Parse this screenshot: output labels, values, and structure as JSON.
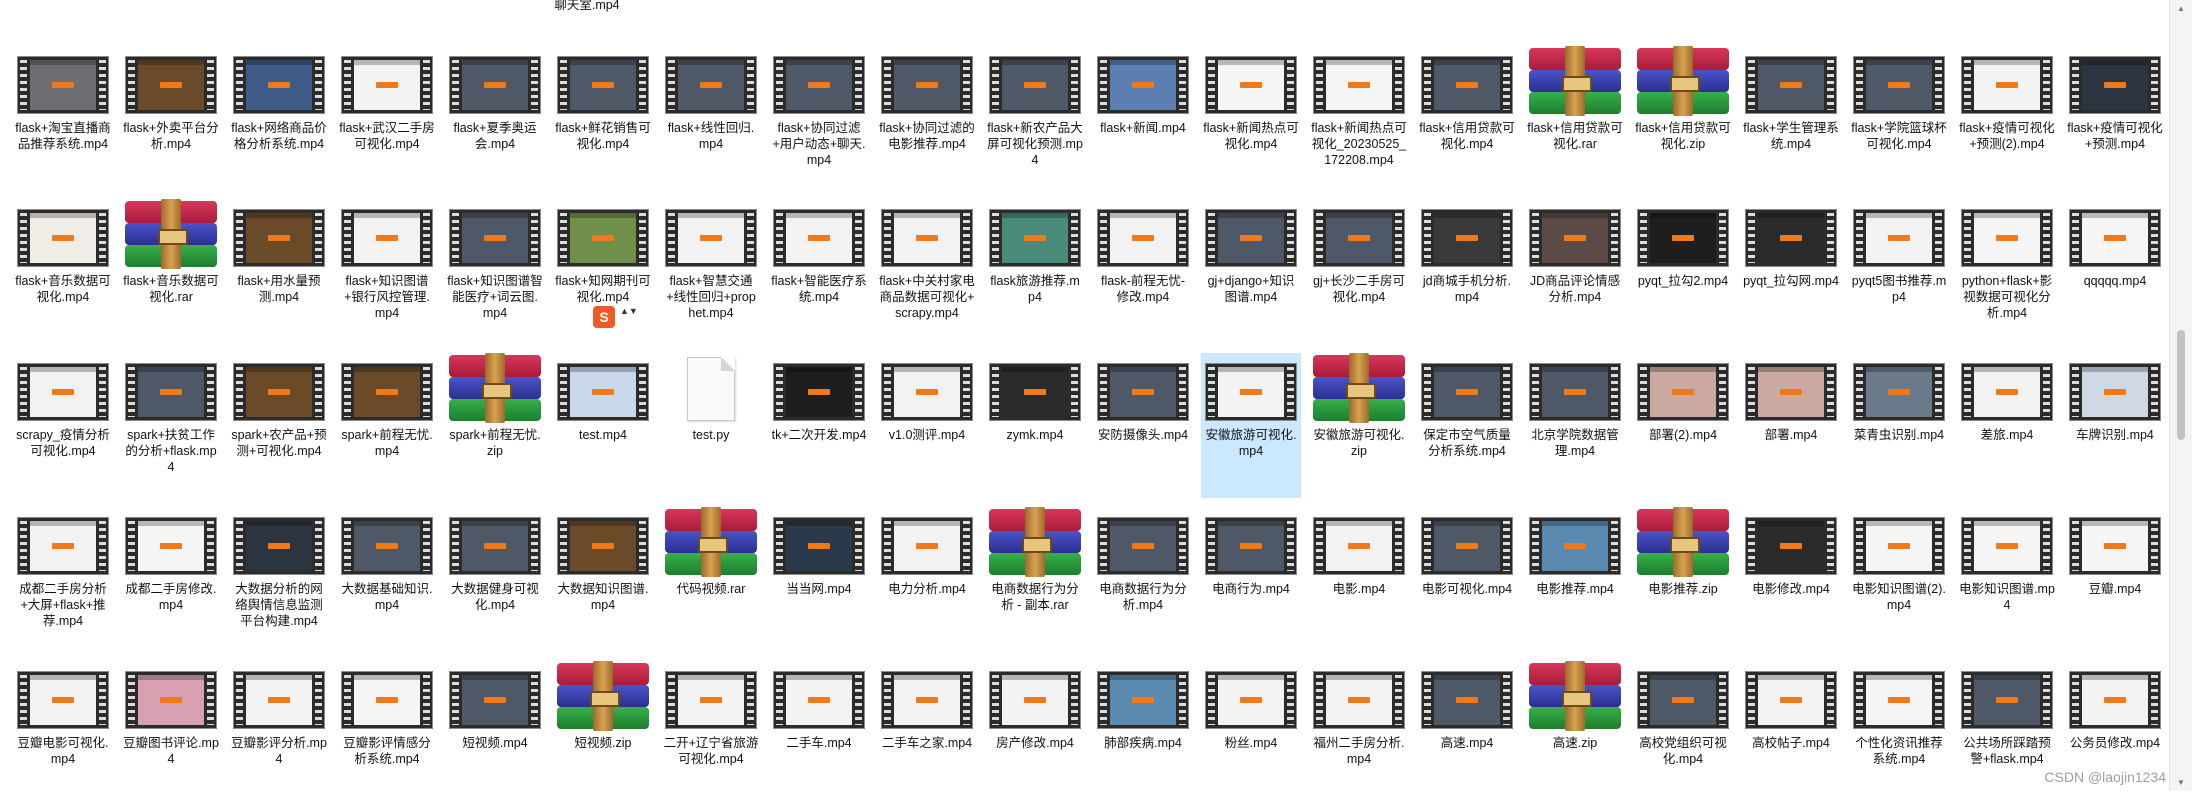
{
  "top_partial_label": "聊天室.mp4",
  "columns_x": [
    13,
    121,
    229,
    337,
    445,
    553,
    661,
    769,
    877,
    985,
    1093,
    1201,
    1309,
    1417,
    1525,
    1633,
    1741,
    1849,
    1957,
    2065
  ],
  "rows_y": [
    56,
    209,
    363,
    517,
    671
  ],
  "files": [
    [
      {
        "name": "flask+淘宝直播商品推荐系统.mp4",
        "type": "video",
        "theme": "#6c6e72"
      },
      {
        "name": "flask+外卖平台分析.mp4",
        "type": "video",
        "theme": "#6b4a2a"
      },
      {
        "name": "flask+网络商品价格分析系统.mp4",
        "type": "video",
        "theme": "#3e5a86"
      },
      {
        "name": "flask+武汉二手房可视化.mp4",
        "type": "video",
        "theme": "#f2f2f2"
      },
      {
        "name": "flask+夏季奥运会.mp4",
        "type": "video",
        "theme": "#4f5866"
      },
      {
        "name": "flask+鲜花销售可视化.mp4",
        "type": "video",
        "theme": "#4f5866"
      },
      {
        "name": "flask+线性回归.mp4",
        "type": "video",
        "theme": "#4f5866"
      },
      {
        "name": "flask+协同过滤+用户动态+聊天.mp4",
        "type": "video",
        "theme": "#4f5866"
      },
      {
        "name": "flask+协同过滤的电影推荐.mp4",
        "type": "video",
        "theme": "#4f5866"
      },
      {
        "name": "flask+新农产品大屏可视化预测.mp4",
        "type": "video",
        "theme": "#4f5866"
      },
      {
        "name": "flask+新闻.mp4",
        "type": "video",
        "theme": "#5a7fb0"
      },
      {
        "name": "flask+新闻热点可视化.mp4",
        "type": "video",
        "theme": "#f5f5f5"
      },
      {
        "name": "flask+新闻热点可视化_20230525_172208.mp4",
        "type": "video",
        "theme": "#f5f5f5"
      },
      {
        "name": "flask+信用贷款可视化.mp4",
        "type": "video",
        "theme": "#4f5866"
      },
      {
        "name": "flask+信用贷款可视化.rar",
        "type": "archive"
      },
      {
        "name": "flask+信用贷款可视化.zip",
        "type": "archive"
      },
      {
        "name": "flask+学生管理系统.mp4",
        "type": "video",
        "theme": "#4f5866"
      },
      {
        "name": "flask+学院篮球杯可视化.mp4",
        "type": "video",
        "theme": "#4f5866"
      },
      {
        "name": "flask+疫情可视化+预测(2).mp4",
        "type": "video",
        "theme": "#f2f2f2"
      },
      {
        "name": "flask+疫情可视化+预测.mp4",
        "type": "video",
        "theme": "#2c3440"
      }
    ],
    [
      {
        "name": "flask+音乐数据可视化.mp4",
        "type": "video",
        "theme": "#f0ede6"
      },
      {
        "name": "flask+音乐数据可视化.rar",
        "type": "archive"
      },
      {
        "name": "flask+用水量预测.mp4",
        "type": "video",
        "theme": "#6b4a2a"
      },
      {
        "name": "flask+知识图谱+银行风控管理.mp4",
        "type": "video",
        "theme": "#f2f2f2"
      },
      {
        "name": "flask+知识图谱智能医疗+词云图.mp4",
        "type": "video",
        "theme": "#4f5866"
      },
      {
        "name": "flask+知网期刊可视化.mp4",
        "type": "video",
        "theme": "#6f8f4a"
      },
      {
        "name": "flask+智慧交通+线性回归+prophet.mp4",
        "type": "video",
        "theme": "#f2f2f2"
      },
      {
        "name": "flask+智能医疗系统.mp4",
        "type": "video",
        "theme": "#f2f2f2"
      },
      {
        "name": "flask+中关村家电商品数据可视化+scrapy.mp4",
        "type": "video",
        "theme": "#f2f2f2"
      },
      {
        "name": "flask旅游推荐.mp4",
        "type": "video",
        "theme": "#4a8a7a"
      },
      {
        "name": "flask-前程无忧-修改.mp4",
        "type": "video",
        "theme": "#f2f2f2"
      },
      {
        "name": "gj+django+知识图谱.mp4",
        "type": "video",
        "theme": "#4f5866"
      },
      {
        "name": "gj+长沙二手房可视化.mp4",
        "type": "video",
        "theme": "#4f5866"
      },
      {
        "name": "jd商城手机分析.mp4",
        "type": "video",
        "theme": "#3a3a3a"
      },
      {
        "name": "JD商品评论情感分析.mp4",
        "type": "video",
        "theme": "#5b4a45"
      },
      {
        "name": "pyqt_拉勾2.mp4",
        "type": "video",
        "theme": "#1e1e1e"
      },
      {
        "name": "pyqt_拉勾网.mp4",
        "type": "video",
        "theme": "#2a2a2a"
      },
      {
        "name": "pyqt5图书推荐.mp4",
        "type": "video",
        "theme": "#f2f2f2"
      },
      {
        "name": "python+flask+影视数据可视化分析.mp4",
        "type": "video",
        "theme": "#f5f5f5"
      },
      {
        "name": "qqqqq.mp4",
        "type": "video",
        "theme": "#f5f5f5"
      }
    ],
    [
      {
        "name": "scrapy_疫情分析可视化.mp4",
        "type": "video",
        "theme": "#f2f2f2"
      },
      {
        "name": "spark+扶贫工作的分析+flask.mp4",
        "type": "video",
        "theme": "#4f5866"
      },
      {
        "name": "spark+农产品+预测+可视化.mp4",
        "type": "video",
        "theme": "#6b4a2a"
      },
      {
        "name": "spark+前程无忧.mp4",
        "type": "video",
        "theme": "#6b4a2a"
      },
      {
        "name": "spark+前程无忧.zip",
        "type": "archive"
      },
      {
        "name": "test.mp4",
        "type": "video",
        "theme": "#c9d8ea"
      },
      {
        "name": "test.py",
        "type": "py"
      },
      {
        "name": "tk+二次开发.mp4",
        "type": "video",
        "theme": "#1e1e1e"
      },
      {
        "name": "v1.0测评.mp4",
        "type": "video",
        "theme": "#f2f2f2"
      },
      {
        "name": "zymk.mp4",
        "type": "video",
        "theme": "#2a2a2a"
      },
      {
        "name": "安防摄像头.mp4",
        "type": "video",
        "theme": "#4f5866"
      },
      {
        "name": "安徽旅游可视化.mp4",
        "type": "video",
        "theme": "#f2f2f2",
        "selected": true
      },
      {
        "name": "安徽旅游可视化.zip",
        "type": "archive"
      },
      {
        "name": "保定市空气质量分析系统.mp4",
        "type": "video",
        "theme": "#4f5866"
      },
      {
        "name": "北京学院数据管理.mp4",
        "type": "video",
        "theme": "#4f5866"
      },
      {
        "name": "部署(2).mp4",
        "type": "video",
        "theme": "#c9a9a0"
      },
      {
        "name": "部署.mp4",
        "type": "video",
        "theme": "#c9a9a0"
      },
      {
        "name": "菜青虫识别.mp4",
        "type": "video",
        "theme": "#6a7a8a"
      },
      {
        "name": "差旅.mp4",
        "type": "video",
        "theme": "#f2f2f2"
      },
      {
        "name": "车牌识别.mp4",
        "type": "video",
        "theme": "#d0d8e4"
      }
    ],
    [
      {
        "name": "成都二手房分析+大屏+flask+推荐.mp4",
        "type": "video",
        "theme": "#f2f2f2"
      },
      {
        "name": "成都二手房修改.mp4",
        "type": "video",
        "theme": "#f5f5f5"
      },
      {
        "name": "大数据分析的网络舆情信息监测平台构建.mp4",
        "type": "video",
        "theme": "#2c3440"
      },
      {
        "name": "大数据基础知识.mp4",
        "type": "video",
        "theme": "#4f5866"
      },
      {
        "name": "大数据健身可视化.mp4",
        "type": "video",
        "theme": "#4f5866"
      },
      {
        "name": "大数据知识图谱.mp4",
        "type": "video",
        "theme": "#6b4a2a"
      },
      {
        "name": "代码视频.rar",
        "type": "archive"
      },
      {
        "name": "当当网.mp4",
        "type": "video",
        "theme": "#2a3a4a"
      },
      {
        "name": "电力分析.mp4",
        "type": "video",
        "theme": "#f2f2f2"
      },
      {
        "name": "电商数据行为分析 - 副本.rar",
        "type": "archive"
      },
      {
        "name": "电商数据行为分析.mp4",
        "type": "video",
        "theme": "#4f5866"
      },
      {
        "name": "电商行为.mp4",
        "type": "video",
        "theme": "#4f5866"
      },
      {
        "name": "电影.mp4",
        "type": "video",
        "theme": "#f2f2f2"
      },
      {
        "name": "电影可视化.mp4",
        "type": "video",
        "theme": "#4f5866"
      },
      {
        "name": "电影推荐.mp4",
        "type": "video",
        "theme": "#5a8ab0"
      },
      {
        "name": "电影推荐.zip",
        "type": "archive"
      },
      {
        "name": "电影修改.mp4",
        "type": "video",
        "theme": "#2a2a2a"
      },
      {
        "name": "电影知识图谱(2).mp4",
        "type": "video",
        "theme": "#f5f5f5"
      },
      {
        "name": "电影知识图谱.mp4",
        "type": "video",
        "theme": "#f5f5f5"
      },
      {
        "name": "豆瓣.mp4",
        "type": "video",
        "theme": "#f5f5f5"
      }
    ],
    [
      {
        "name": "豆瓣电影可视化.mp4",
        "type": "video",
        "theme": "#f2f2f2"
      },
      {
        "name": "豆瓣图书评论.mp4",
        "type": "video",
        "theme": "#d8a0b0"
      },
      {
        "name": "豆瓣影评分析.mp4",
        "type": "video",
        "theme": "#f2f2f2"
      },
      {
        "name": "豆瓣影评情感分析系统.mp4",
        "type": "video",
        "theme": "#f5f5f5"
      },
      {
        "name": "短视频.mp4",
        "type": "video",
        "theme": "#4f5866"
      },
      {
        "name": "短视频.zip",
        "type": "archive"
      },
      {
        "name": "二开+辽宁省旅游可视化.mp4",
        "type": "video",
        "theme": "#f2f2f2"
      },
      {
        "name": "二手车.mp4",
        "type": "video",
        "theme": "#f2f2f2"
      },
      {
        "name": "二手车之家.mp4",
        "type": "video",
        "theme": "#f2f2f2"
      },
      {
        "name": "房产修改.mp4",
        "type": "video",
        "theme": "#f2f2f2"
      },
      {
        "name": "肺部疾病.mp4",
        "type": "video",
        "theme": "#5a8ab0"
      },
      {
        "name": "粉丝.mp4",
        "type": "video",
        "theme": "#f2f2f2"
      },
      {
        "name": "福州二手房分析.mp4",
        "type": "video",
        "theme": "#f2f2f2"
      },
      {
        "name": "高速.mp4",
        "type": "video",
        "theme": "#4f5866"
      },
      {
        "name": "高速.zip",
        "type": "archive"
      },
      {
        "name": "高校党组织可视化.mp4",
        "type": "video",
        "theme": "#4f5866"
      },
      {
        "name": "高校帖子.mp4",
        "type": "video",
        "theme": "#f2f2f2"
      },
      {
        "name": "个性化资讯推荐系统.mp4",
        "type": "video",
        "theme": "#f5f5f5"
      },
      {
        "name": "公共场所踩踏预警+flask.mp4",
        "type": "video",
        "theme": "#4f5866"
      },
      {
        "name": "公务员修改.mp4",
        "type": "video",
        "theme": "#f2f2f2"
      }
    ]
  ],
  "overlay_icon_text": "S",
  "overlay_arrows": "▲▼",
  "scroll_up_glyph": "▲",
  "scroll_down_glyph": "▼",
  "watermark": "CSDN @laojin1234"
}
